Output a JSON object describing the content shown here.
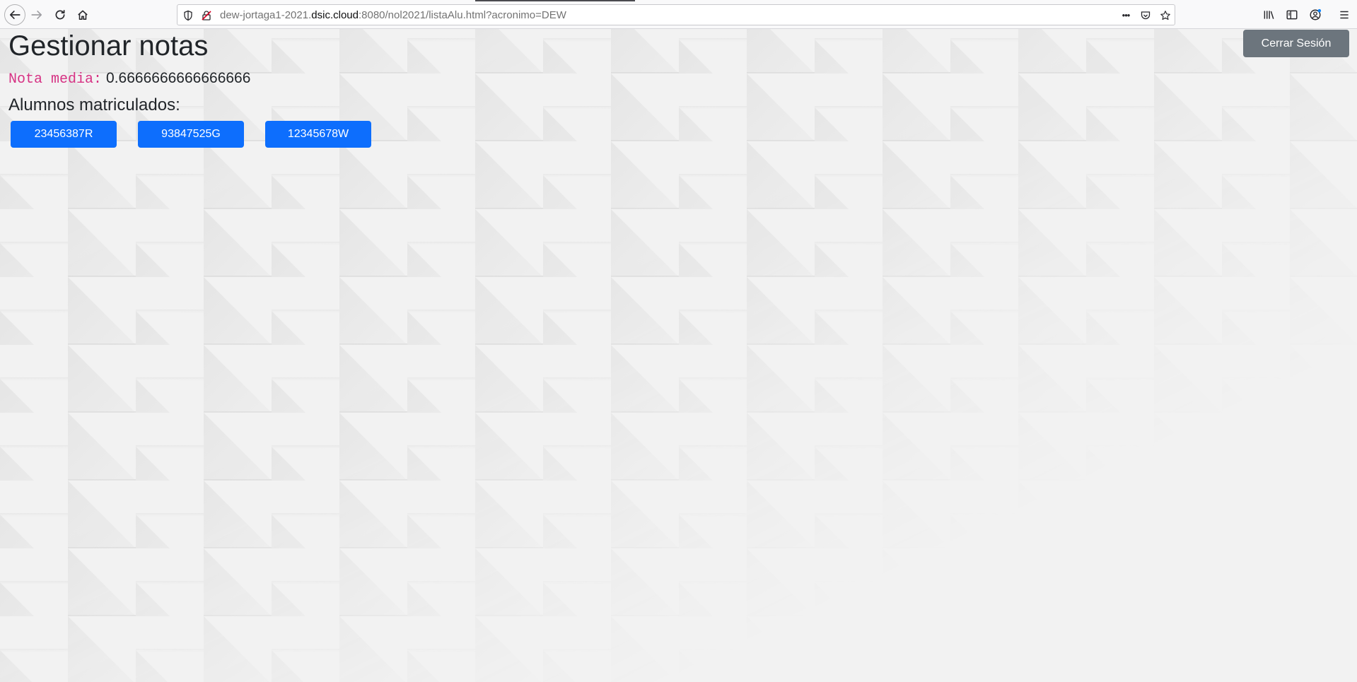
{
  "browser": {
    "url_prefix": "dew-jortaga1-2021.",
    "url_host": "dsic.cloud",
    "url_suffix": ":8080/nol2021/listaAlu.html?acronimo=DEW",
    "more_label": "•••"
  },
  "page": {
    "title": "Gestionar notas",
    "average_label": "Nota media:",
    "average_value": "0.6666666666666666",
    "students_label": "Alumnos matriculados:",
    "students": [
      {
        "id": "23456387R"
      },
      {
        "id": "93847525G"
      },
      {
        "id": "12345678W"
      }
    ],
    "logout_label": "Cerrar Sesión"
  },
  "colors": {
    "primary": "#0d6efd",
    "secondary": "#6c757d",
    "code": "#d63384",
    "background": "#f2f2f2"
  }
}
